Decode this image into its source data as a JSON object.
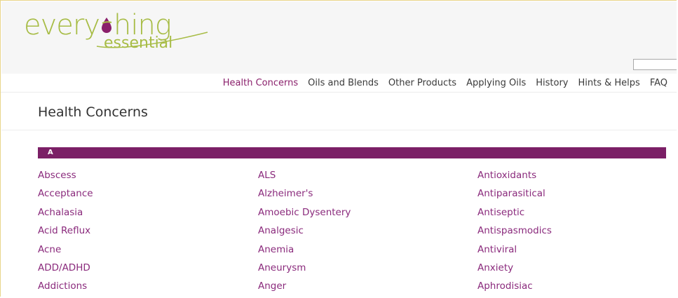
{
  "logo": {
    "word1_start": "every",
    "word1_end": "hing",
    "word2": "essential",
    "colors": {
      "green": "#a7bc45",
      "drop": "#8a1f6b"
    }
  },
  "search": {
    "value": "",
    "placeholder": ""
  },
  "nav": {
    "items": [
      {
        "label": "Health Concerns",
        "active": true
      },
      {
        "label": "Oils and Blends",
        "active": false
      },
      {
        "label": "Other Products",
        "active": false
      },
      {
        "label": "Applying Oils",
        "active": false
      },
      {
        "label": "History",
        "active": false
      },
      {
        "label": "Hints & Helps",
        "active": false
      },
      {
        "label": "FAQ",
        "active": false
      }
    ]
  },
  "main": {
    "title": "Health Concerns",
    "letter": "A",
    "columns": [
      [
        "Abscess",
        "Acceptance",
        "Achalasia",
        "Acid Reflux",
        "Acne",
        "ADD/ADHD",
        "Addictions"
      ],
      [
        "ALS",
        "Alzheimer's",
        "Amoebic Dysentery",
        "Analgesic",
        "Anemia",
        "Aneurysm",
        "Anger"
      ],
      [
        "Antioxidants",
        "Antiparasitical",
        "Antiseptic",
        "Antispasmodics",
        "Antiviral",
        "Anxiety",
        "Aphrodisiac"
      ]
    ]
  },
  "colors": {
    "accent": "#7b1f66",
    "link": "#8a2a7c",
    "nav_text": "#3a3a3a",
    "header_bg": "#f6f6f6"
  }
}
